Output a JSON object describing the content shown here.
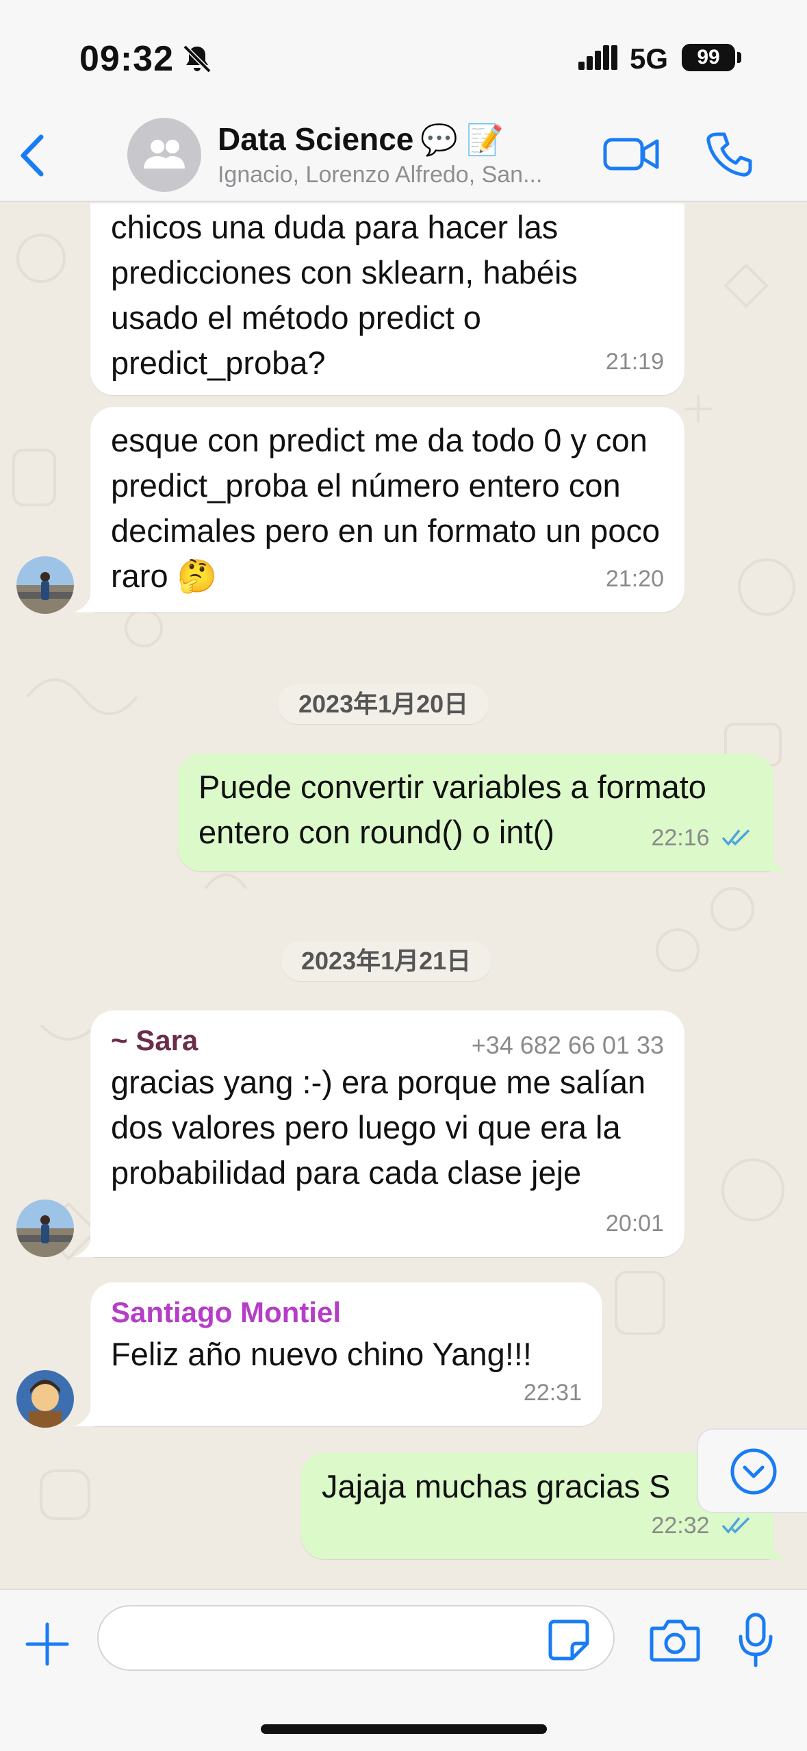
{
  "status_bar": {
    "time": "09:32",
    "network": "5G",
    "battery": "99"
  },
  "header": {
    "back_label": "‹",
    "title": "Data Science",
    "title_emoji": "💬 📝",
    "subtitle": "Ignacio, Lorenzo Alfredo, San..."
  },
  "messages": [
    {
      "direction": "in",
      "text": "chicos una duda para hacer las predicciones con sklearn, habéis usado el método predict o predict_proba?",
      "time": "21:19"
    },
    {
      "direction": "in",
      "text": "esque con predict me da todo 0 y con predict_proba el número entero con decimales pero en un formato un poco raro 🤔",
      "time": "21:20"
    },
    {
      "direction": "out",
      "text": "Puede convertir variables a formato entero con round() o int()",
      "time": "22:16",
      "status": "read"
    },
    {
      "direction": "in",
      "sender": "~ Sara",
      "sender_phone": "+34 682 66 01 33",
      "text": "gracias yang :-) era porque me salían dos valores pero luego vi que era la probabilidad para cada clase jeje",
      "time": "20:01"
    },
    {
      "direction": "in",
      "sender": "Santiago Montiel",
      "text": "Feliz año nuevo chino Yang!!!",
      "time": "22:31"
    },
    {
      "direction": "out",
      "text": "Jajaja muchas gracias S",
      "time": "22:32",
      "status": "read"
    }
  ],
  "date_separators": [
    "2023年1月20日",
    "2023年1月21日"
  ],
  "colors": {
    "accent": "#1a7cf5",
    "outgoing_bubble": "#dbf9c9",
    "incoming_bubble": "#ffffff",
    "sara_name": "#6b2d4a",
    "santiago_name": "#b63dc8",
    "read_ticks": "#4fa3e0"
  },
  "input": {
    "placeholder": ""
  },
  "icons": [
    "back-chevron-icon",
    "group-avatar-icon",
    "video-call-icon",
    "phone-call-icon",
    "plus-icon",
    "sticker-icon",
    "camera-icon",
    "microphone-icon",
    "scroll-down-icon",
    "bell-slash-icon",
    "signal-icon"
  ]
}
